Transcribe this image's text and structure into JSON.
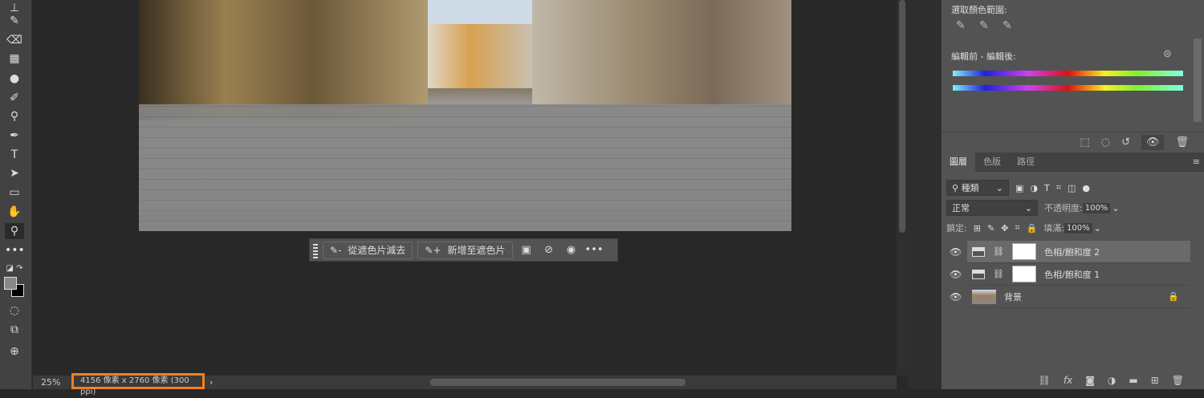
{
  "status": {
    "zoom": "25%",
    "doc_info": "4156 像素 x 2760 像素 (300 ppi)"
  },
  "mask_toolbar": {
    "subtract_label": "從遮色片減去",
    "add_label": "新增至遮色片"
  },
  "properties": {
    "select_color_range": "選取顏色範圍:",
    "before_after": "編輯前 - 編輯後:"
  },
  "layers_panel": {
    "tabs": [
      "圖層",
      "色版",
      "路徑"
    ],
    "filter_kind": "種類",
    "blend_mode": "正常",
    "opacity_label": "不透明度:",
    "opacity": "100%",
    "lock_label": "鎖定:",
    "fill_label": "填滿:",
    "fill": "100%",
    "layers": [
      {
        "name": "色相/飽和度 2"
      },
      {
        "name": "色相/飽和度 1"
      },
      {
        "name": "背景"
      }
    ]
  }
}
